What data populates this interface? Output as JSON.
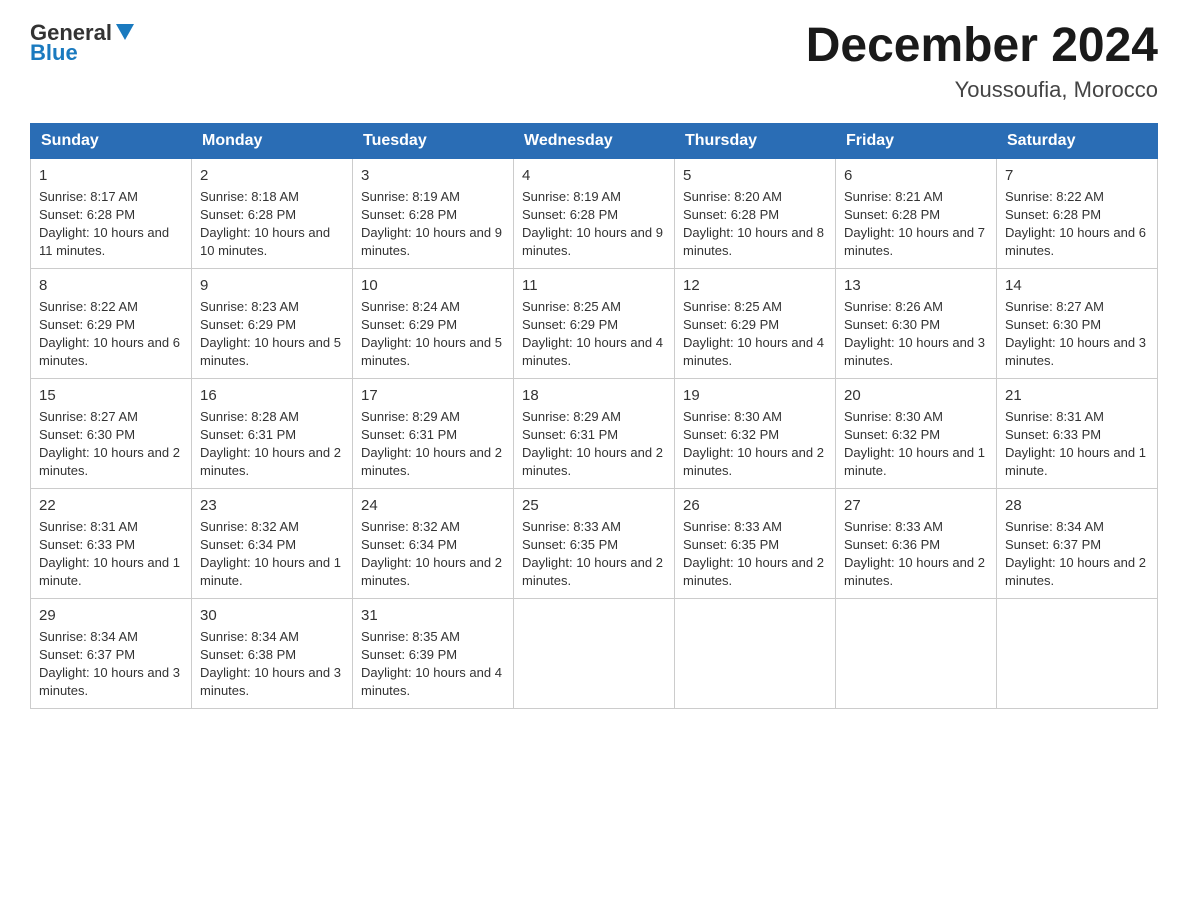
{
  "header": {
    "logo_general": "General",
    "logo_blue": "Blue",
    "month_title": "December 2024",
    "location": "Youssoufia, Morocco"
  },
  "days_of_week": [
    "Sunday",
    "Monday",
    "Tuesday",
    "Wednesday",
    "Thursday",
    "Friday",
    "Saturday"
  ],
  "weeks": [
    [
      {
        "day": "1",
        "sunrise": "8:17 AM",
        "sunset": "6:28 PM",
        "daylight": "10 hours and 11 minutes."
      },
      {
        "day": "2",
        "sunrise": "8:18 AM",
        "sunset": "6:28 PM",
        "daylight": "10 hours and 10 minutes."
      },
      {
        "day": "3",
        "sunrise": "8:19 AM",
        "sunset": "6:28 PM",
        "daylight": "10 hours and 9 minutes."
      },
      {
        "day": "4",
        "sunrise": "8:19 AM",
        "sunset": "6:28 PM",
        "daylight": "10 hours and 9 minutes."
      },
      {
        "day": "5",
        "sunrise": "8:20 AM",
        "sunset": "6:28 PM",
        "daylight": "10 hours and 8 minutes."
      },
      {
        "day": "6",
        "sunrise": "8:21 AM",
        "sunset": "6:28 PM",
        "daylight": "10 hours and 7 minutes."
      },
      {
        "day": "7",
        "sunrise": "8:22 AM",
        "sunset": "6:28 PM",
        "daylight": "10 hours and 6 minutes."
      }
    ],
    [
      {
        "day": "8",
        "sunrise": "8:22 AM",
        "sunset": "6:29 PM",
        "daylight": "10 hours and 6 minutes."
      },
      {
        "day": "9",
        "sunrise": "8:23 AM",
        "sunset": "6:29 PM",
        "daylight": "10 hours and 5 minutes."
      },
      {
        "day": "10",
        "sunrise": "8:24 AM",
        "sunset": "6:29 PM",
        "daylight": "10 hours and 5 minutes."
      },
      {
        "day": "11",
        "sunrise": "8:25 AM",
        "sunset": "6:29 PM",
        "daylight": "10 hours and 4 minutes."
      },
      {
        "day": "12",
        "sunrise": "8:25 AM",
        "sunset": "6:29 PM",
        "daylight": "10 hours and 4 minutes."
      },
      {
        "day": "13",
        "sunrise": "8:26 AM",
        "sunset": "6:30 PM",
        "daylight": "10 hours and 3 minutes."
      },
      {
        "day": "14",
        "sunrise": "8:27 AM",
        "sunset": "6:30 PM",
        "daylight": "10 hours and 3 minutes."
      }
    ],
    [
      {
        "day": "15",
        "sunrise": "8:27 AM",
        "sunset": "6:30 PM",
        "daylight": "10 hours and 2 minutes."
      },
      {
        "day": "16",
        "sunrise": "8:28 AM",
        "sunset": "6:31 PM",
        "daylight": "10 hours and 2 minutes."
      },
      {
        "day": "17",
        "sunrise": "8:29 AM",
        "sunset": "6:31 PM",
        "daylight": "10 hours and 2 minutes."
      },
      {
        "day": "18",
        "sunrise": "8:29 AM",
        "sunset": "6:31 PM",
        "daylight": "10 hours and 2 minutes."
      },
      {
        "day": "19",
        "sunrise": "8:30 AM",
        "sunset": "6:32 PM",
        "daylight": "10 hours and 2 minutes."
      },
      {
        "day": "20",
        "sunrise": "8:30 AM",
        "sunset": "6:32 PM",
        "daylight": "10 hours and 1 minute."
      },
      {
        "day": "21",
        "sunrise": "8:31 AM",
        "sunset": "6:33 PM",
        "daylight": "10 hours and 1 minute."
      }
    ],
    [
      {
        "day": "22",
        "sunrise": "8:31 AM",
        "sunset": "6:33 PM",
        "daylight": "10 hours and 1 minute."
      },
      {
        "day": "23",
        "sunrise": "8:32 AM",
        "sunset": "6:34 PM",
        "daylight": "10 hours and 1 minute."
      },
      {
        "day": "24",
        "sunrise": "8:32 AM",
        "sunset": "6:34 PM",
        "daylight": "10 hours and 2 minutes."
      },
      {
        "day": "25",
        "sunrise": "8:33 AM",
        "sunset": "6:35 PM",
        "daylight": "10 hours and 2 minutes."
      },
      {
        "day": "26",
        "sunrise": "8:33 AM",
        "sunset": "6:35 PM",
        "daylight": "10 hours and 2 minutes."
      },
      {
        "day": "27",
        "sunrise": "8:33 AM",
        "sunset": "6:36 PM",
        "daylight": "10 hours and 2 minutes."
      },
      {
        "day": "28",
        "sunrise": "8:34 AM",
        "sunset": "6:37 PM",
        "daylight": "10 hours and 2 minutes."
      }
    ],
    [
      {
        "day": "29",
        "sunrise": "8:34 AM",
        "sunset": "6:37 PM",
        "daylight": "10 hours and 3 minutes."
      },
      {
        "day": "30",
        "sunrise": "8:34 AM",
        "sunset": "6:38 PM",
        "daylight": "10 hours and 3 minutes."
      },
      {
        "day": "31",
        "sunrise": "8:35 AM",
        "sunset": "6:39 PM",
        "daylight": "10 hours and 4 minutes."
      },
      null,
      null,
      null,
      null
    ]
  ]
}
